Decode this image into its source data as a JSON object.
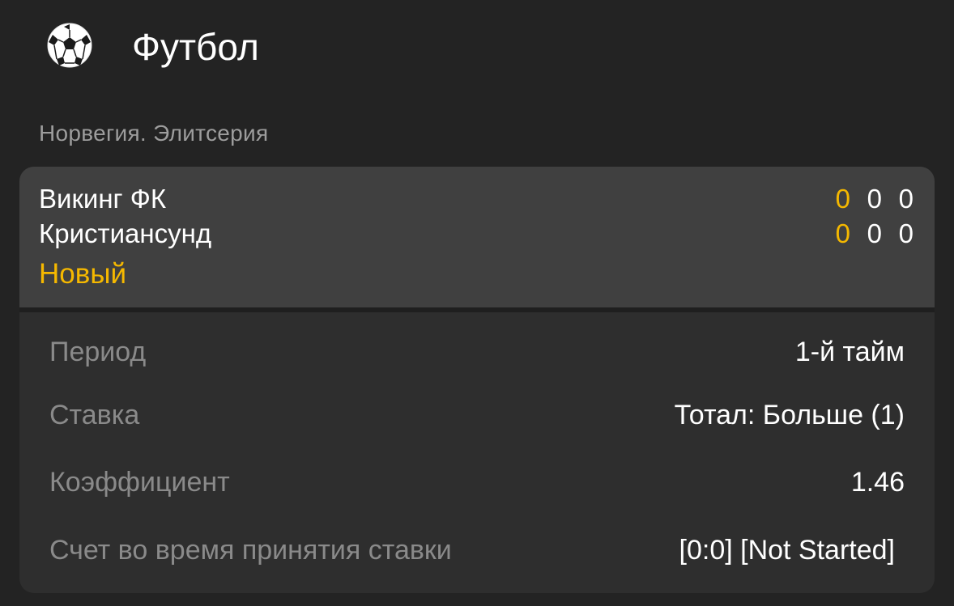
{
  "header": {
    "icon": "soccer-ball-icon",
    "title": "Футбол"
  },
  "league": "Норвегия. Элитсерия",
  "match": {
    "home_team": "Викинг ФК",
    "away_team": "Кристиансунд",
    "home_scores": [
      "0",
      "0",
      "0"
    ],
    "away_scores": [
      "0",
      "0",
      "0"
    ],
    "status": "Новый",
    "accent_color": "#f5b800"
  },
  "details": [
    {
      "label": "Период",
      "value": "1-й тайм"
    },
    {
      "label": "Ставка",
      "value": "Тотал: Больше (1)"
    },
    {
      "label": "Коэффициент",
      "value": "1.46"
    },
    {
      "label": "Счет во время принятия ставки",
      "value": "[0:0] [Not Started]"
    }
  ]
}
